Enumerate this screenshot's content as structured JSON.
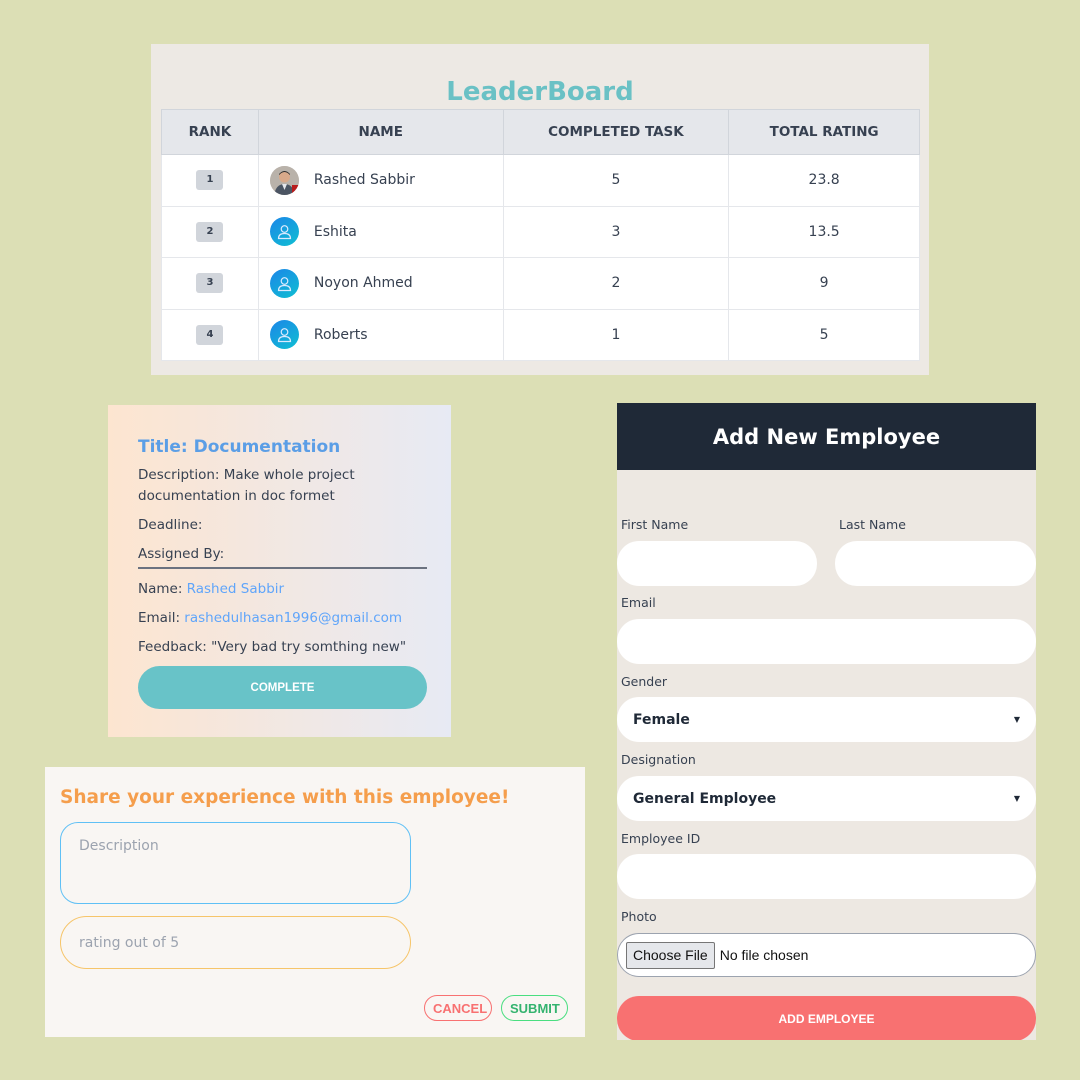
{
  "leaderboard": {
    "title": "LeaderBoard",
    "headers": [
      "RANK",
      "NAME",
      "COMPLETED TASK",
      "TOTAL RATING"
    ],
    "rows": [
      {
        "rank": "1",
        "name": "Rashed Sabbir",
        "completed": "5",
        "rating": "23.8",
        "avatar": "user-photo"
      },
      {
        "rank": "2",
        "name": "Eshita",
        "completed": "3",
        "rating": "13.5",
        "avatar": "default-user-icon"
      },
      {
        "rank": "3",
        "name": "Noyon Ahmed",
        "completed": "2",
        "rating": "9",
        "avatar": "default-user-icon"
      },
      {
        "rank": "4",
        "name": "Roberts",
        "completed": "1",
        "rating": "5",
        "avatar": "default-user-icon"
      }
    ]
  },
  "task_card": {
    "title": "Title: Documentation",
    "description": "Description: Make whole project documentation in doc formet",
    "deadline_label": "Deadline:",
    "assigned_by_label": "Assigned By:",
    "name_label": "Name: ",
    "name_value": "Rashed Sabbir",
    "email_label": "Email: ",
    "email_value": "rashedulhasan1996@gmail.com",
    "feedback": "Feedback: \"Very bad try somthing new\"",
    "complete_label": "COMPLETE"
  },
  "feedback_form": {
    "title": "Share your experience with this employee!",
    "description_placeholder": "Description",
    "rating_placeholder": "rating out of 5",
    "cancel_label": "CANCEL",
    "submit_label": "SUBMIT"
  },
  "employee_form": {
    "title": "Add New Employee",
    "first_name_label": "First Name",
    "last_name_label": "Last Name",
    "email_label": "Email",
    "gender_label": "Gender",
    "gender_value": "Female",
    "designation_label": "Designation",
    "designation_value": "General Employee",
    "employee_id_label": "Employee ID",
    "photo_label": "Photo",
    "choose_file_label": "Choose File",
    "file_status": "No file chosen",
    "submit_label": "ADD EMPLOYEE"
  },
  "colors": {
    "background": "#dcdfb5",
    "teal_accent": "#6ac1c5",
    "orange_accent": "#f59e4c",
    "header_dark": "#1f2937",
    "add_button": "#f87171"
  }
}
